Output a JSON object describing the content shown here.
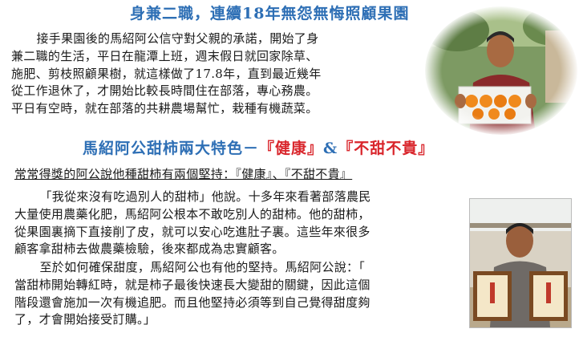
{
  "section1": {
    "title": "身兼二職，連續18年無怨無悔照顧果園",
    "paragraph_lines": [
      "接手果園後的馬紹阿公信守對父親的承諾，開始了身",
      "兼二職的生活，平日在龍潭上班，週末假日就回家除草、",
      "施肥、剪枝照顧果樹，就這樣做了17.8年，直到最近幾年",
      "從工作退休了，才開始比較長時間住在部落，專心務農。",
      "平日有空時，就在部落的共耕農場幫忙，栽種有機蔬菜。"
    ]
  },
  "section2": {
    "title_prefix": "馬紹阿公甜柿兩大特色－",
    "title_highlight1": "『健康』",
    "title_amp": "&",
    "title_highlight2": "『不甜不貴』",
    "intro": "常常得獎的阿公說他種甜柿有兩個堅持：『健康』、『不甜不貴』",
    "paragraph1_lines": [
      "「我從來沒有吃過別人的甜柿」他說。十多年來看著部落農民",
      "大量使用農藥化肥，馬紹阿公根本不敢吃別人的甜柿。他的甜柿，",
      "從果園裏摘下直接削了皮，就可以安心吃進肚子裏。這些年來很多",
      "顧客拿甜柿去做農藥檢驗，後來都成為忠實顧客。"
    ],
    "paragraph2_lines": [
      "至於如何確保甜度，馬紹阿公也有他的堅持。馬紹阿公說：「",
      "當甜柿開始轉紅時，就是柿子最後快速長大變甜的關鍵，因此這個",
      "階段還會施加一次有機追肥。而且他堅持必須等到自己覺得甜度夠",
      "了，才會開始接受訂購。」"
    ]
  },
  "photos": {
    "photo1_icon": "farmer-holding-fruit-box-photo",
    "photo2_icon": "farmer-holding-award-certificates-photo"
  },
  "colors": {
    "heading_blue": "#2e6fb5",
    "highlight_red": "#d9262c",
    "persimmon_orange": "#f08a1c"
  }
}
